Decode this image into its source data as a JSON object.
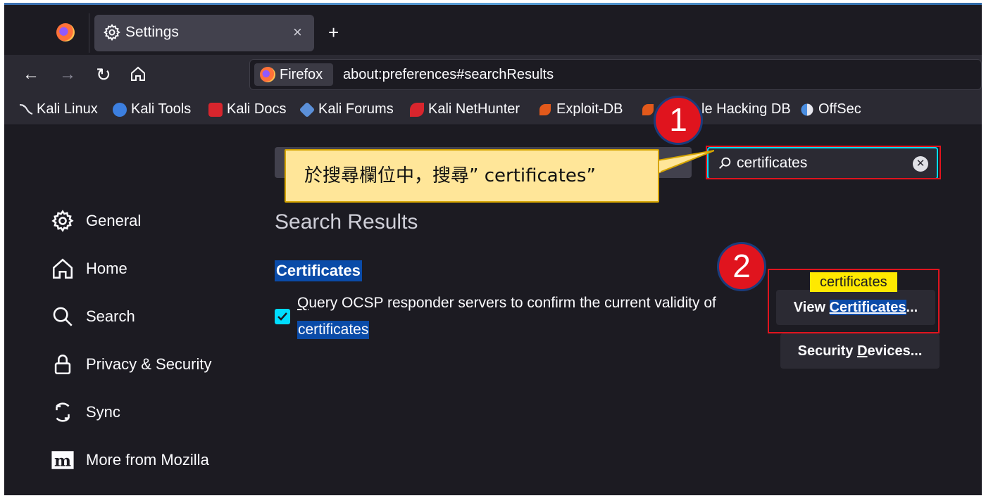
{
  "tab": {
    "title": "Settings",
    "close_glyph": "×",
    "new_tab_glyph": "+"
  },
  "nav": {
    "back": "←",
    "forward": "→",
    "reload": "↻"
  },
  "urlbar": {
    "identity_label": "Firefox",
    "url": "about:preferences#searchResults"
  },
  "bookmarks": [
    {
      "label": "Kali Linux",
      "icon": "kali-dragon-icon",
      "color": "#e8e8ee"
    },
    {
      "label": "Kali Tools",
      "icon": "kali-tools-icon",
      "color": "#3c7fe0"
    },
    {
      "label": "Kali Docs",
      "icon": "kali-docs-icon",
      "color": "#d8252d"
    },
    {
      "label": "Kali Forums",
      "icon": "kali-forums-icon",
      "color": "#5b8fd8"
    },
    {
      "label": "Kali NetHunter",
      "icon": "nethunter-icon",
      "color": "#d8252d"
    },
    {
      "label": "Exploit-DB",
      "icon": "exploit-db-icon",
      "color": "#e2591b"
    },
    {
      "label": "le Hacking DB",
      "icon": "google-hacking-db-icon",
      "color": "#e2591b"
    },
    {
      "label": "OffSec",
      "icon": "offsec-icon",
      "color": "#4a8de0"
    }
  ],
  "search": {
    "value": "certificates",
    "clear_glyph": "✕"
  },
  "sidebar": [
    {
      "label": "General",
      "icon": "gear-icon"
    },
    {
      "label": "Home",
      "icon": "home-icon"
    },
    {
      "label": "Search",
      "icon": "search-icon"
    },
    {
      "label": "Privacy & Security",
      "icon": "lock-icon"
    },
    {
      "label": "Sync",
      "icon": "sync-icon"
    },
    {
      "label": "More from Mozilla",
      "icon": "mozilla-icon"
    }
  ],
  "results": {
    "title": "Search Results",
    "heading": "Certificates",
    "ocsp_line1_first": "Q",
    "ocsp_line1_rest": "uery OCSP responder servers to confirm the current validity of",
    "ocsp_line2": "certificates",
    "ocsp_checked": true,
    "tooltip": "certificates",
    "view_prefix": "View ",
    "view_hl_first": "C",
    "view_hl_rest": "ertificates",
    "view_suffix": "...",
    "security_prefix": "Security ",
    "security_accesskey": "D",
    "security_rest": "evices..."
  },
  "annotations": {
    "badge1": "1",
    "badge2": "2",
    "callout": "於搜尋欄位中，搜尋”  certificates”",
    "highlight_color": "#e0141e",
    "callout_color": "#ffe699"
  },
  "colors": {
    "accent": "#00ddff",
    "selection": "#0a4ba8",
    "background": "#1c1b22"
  }
}
